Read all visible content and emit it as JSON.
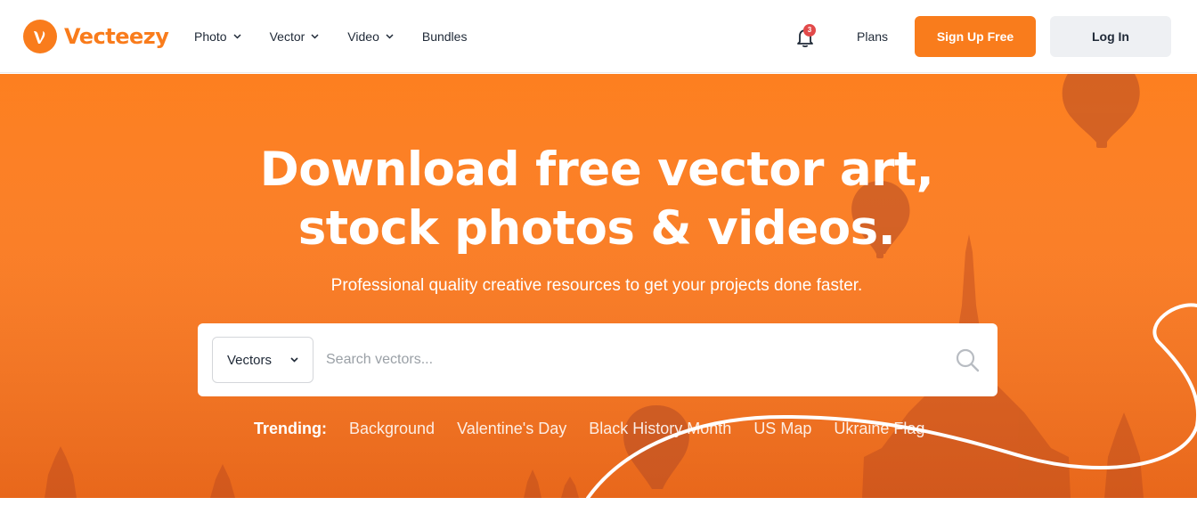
{
  "brand": {
    "name": "Vecteezy",
    "color": "#f97c1c"
  },
  "nav": {
    "items": [
      {
        "label": "Photo",
        "has_dropdown": true
      },
      {
        "label": "Vector",
        "has_dropdown": true
      },
      {
        "label": "Video",
        "has_dropdown": true
      },
      {
        "label": "Bundles",
        "has_dropdown": false
      }
    ],
    "notifications": {
      "icon": "bell-icon",
      "count": "3"
    },
    "plans_label": "Plans",
    "signup_label": "Sign Up Free",
    "login_label": "Log In"
  },
  "hero": {
    "title_line1": "Download free vector art,",
    "title_line2": "stock photos & videos.",
    "subtitle": "Professional quality creative resources to get your projects done faster.",
    "background_color": "#fb7a1f"
  },
  "search": {
    "type_selected": "Vectors",
    "placeholder": "Search vectors...",
    "value": "",
    "icon": "search-icon"
  },
  "trending": {
    "label": "Trending:",
    "items": [
      "Background",
      "Valentine's Day",
      "Black History Month",
      "US Map",
      "Ukraine Flag"
    ]
  }
}
